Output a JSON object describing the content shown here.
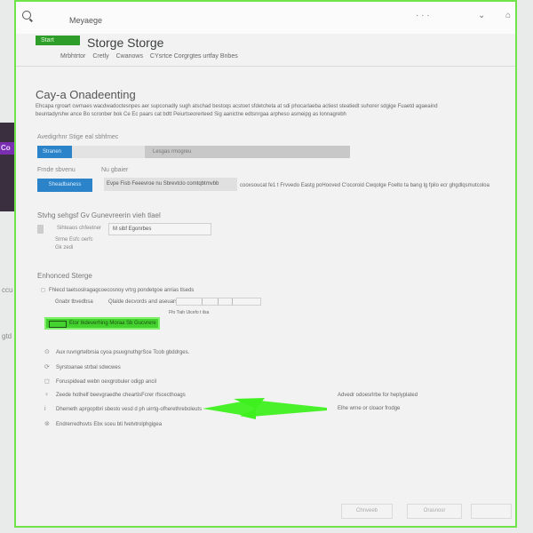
{
  "window": {
    "title": "Meyaege",
    "menu_glyph": "· · ·",
    "minimize_glyph": "⌄",
    "close_glyph": "⌂"
  },
  "header": {
    "badge": "Start",
    "title": "Storge Storge",
    "tabs": [
      "Mrbhtrtor",
      "Cretly",
      "Cwanows",
      "CYsrtce Corgrgtes urtfay Bnbes"
    ]
  },
  "section": {
    "title": "Cay-a Onadeenting",
    "description": "Ehcapa rgroart cwrnaes wacdwadoctesnpes aer supconadly sugh atschad bestoqs acstoet sfdetcheta at sdi phocarlaeba actiest steatiedt suhorer sdgige Fuaetd agaeaind beuntadyrshw ance Bo scronber bok Ce Ec paars cat bdtt Peiurtseorerteed Sig aanictne edtsnrgaa arpheso asmeipg as lonnagrebh",
    "progress_label": "Avedigrhnr Stige eal sbhfmec",
    "progress_seg1": "Stranen",
    "progress_seg2": "Lesgas rmogreu",
    "progress_fraction": 0.11,
    "label_left": "Frnde sbvenu",
    "label_right": "Nu gbaier",
    "button_blue": "Sheadbaness",
    "path_value": "Evpe Fisb Feeevroe nu Sbrevtclo comtqbtmvbb",
    "path_note": "cooxsoucat fe1 t Frvvedo Eastg poHooved C'ocoroid Cwqolge Foelto ta bang lg fpilo ecr ghgdlqsmutcoloa"
  },
  "storage": {
    "heading": "Stvhg sehgsf Gv Gunevreerin vieh tlael",
    "row_label": "Sihteaos chfeetner",
    "field_value": "M sibf Egonrbes",
    "row2": "Srme Esfc oerfc",
    "row3": "Gk                 zedi"
  },
  "enhanced": {
    "heading": "Enhonced Sterge",
    "option1": "Fhlecd taetsoslragagcoecosnoy vrtrg pondetgoe anrias tlseds",
    "option2": "Gnabr tbvedbsa",
    "option2_value": "Qlalde decvords and aseuars",
    "option3": "Ffo  Tiah  Uicefo  t  ilsa",
    "green_button": "Etor tkdeverhing Moraa Sb Gucvrere"
  },
  "list": [
    {
      "icon": "history-icon",
      "glyph": "⊙",
      "text": "Aux ruvngrtelbrsia cyoa psuvgnuthgrSce Tcob gbddrges."
    },
    {
      "icon": "sync-icon",
      "glyph": "⟳",
      "text": "Syrstoanae strbal sdwcwes"
    },
    {
      "icon": "folder-icon",
      "glyph": "◻",
      "text": "Foruspidead webn oexgrobuler odigp ancil"
    },
    {
      "icon": "bulb-icon",
      "glyph": "♀",
      "text": "Zeede hothelf beevgraedhe cheartisFcrer rfscecthoags"
    },
    {
      "icon": "info-icon",
      "glyph": "i",
      "text": "Dhemeth aprgoptbri sbesto vesd d ph uirrtg-ofherethreboleuts"
    },
    {
      "icon": "settings-icon",
      "glyph": "⊚",
      "text": "Endrerredhsvts Ebx sceu bti fvetvtrolphgigea"
    }
  ],
  "right_notes": [
    "Advedr odoesrlrbe for heplyplated",
    "Elhe wrne or cloaor frodge"
  ],
  "footer": {
    "btn1": "Chnveeb",
    "btn2": "Orasnosr",
    "btn3": ""
  },
  "background": {
    "purple_text": "Co",
    "side1": "ccu",
    "side2": "gtd"
  },
  "colors": {
    "accent_green": "#44d22e",
    "accent_blue": "#2b84c9",
    "annotation_green": "#3ff01f"
  }
}
